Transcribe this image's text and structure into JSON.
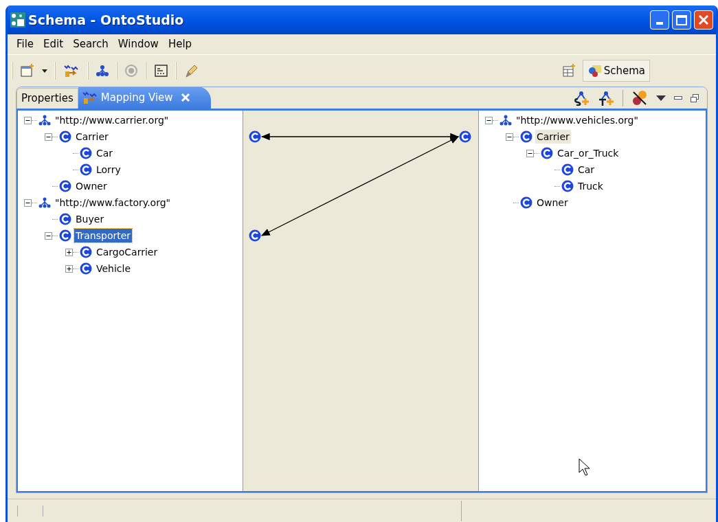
{
  "window": {
    "title": "Schema - OntoStudio"
  },
  "menu": [
    "File",
    "Edit",
    "Search",
    "Window",
    "Help"
  ],
  "perspective": {
    "label": "Schema",
    "selected": true
  },
  "view_tabs": [
    {
      "label": "Properties",
      "selected": false
    },
    {
      "label": "Mapping View",
      "selected": true
    }
  ],
  "source_tree": {
    "focused": true,
    "items": [
      {
        "kind": "ontology",
        "label": "\"http://www.carrier.org\"",
        "expanded": true,
        "selected": false,
        "mapped": false,
        "children": [
          {
            "kind": "class",
            "label": "Carrier",
            "expanded": true,
            "selected": false,
            "mapped": true,
            "children": [
              {
                "kind": "class",
                "label": "Car",
                "selected": false,
                "mapped": false
              },
              {
                "kind": "class",
                "label": "Lorry",
                "selected": false,
                "mapped": false
              }
            ]
          },
          {
            "kind": "class",
            "label": "Owner",
            "selected": false,
            "mapped": false
          }
        ]
      },
      {
        "kind": "ontology",
        "label": "\"http://www.factory.org\"",
        "expanded": true,
        "selected": false,
        "mapped": false,
        "children": [
          {
            "kind": "class",
            "label": "Buyer",
            "selected": false,
            "mapped": false
          },
          {
            "kind": "class",
            "label": "Transporter",
            "expanded": true,
            "selected": true,
            "mapped": true,
            "children": [
              {
                "kind": "class",
                "label": "CargoCarrier",
                "expanded": false,
                "selected": false,
                "mapped": false
              },
              {
                "kind": "class",
                "label": "Vehicle",
                "expanded": false,
                "selected": false,
                "mapped": false
              }
            ]
          }
        ]
      }
    ]
  },
  "target_tree": {
    "focused": false,
    "items": [
      {
        "kind": "ontology",
        "label": "\"http://www.vehicles.org\"",
        "expanded": true,
        "selected": false,
        "mapped": false,
        "children": [
          {
            "kind": "class",
            "label": "Carrier",
            "expanded": true,
            "selected": true,
            "mapped": true,
            "children": [
              {
                "kind": "class",
                "label": "Car_or_Truck",
                "expanded": true,
                "selected": false,
                "mapped": false,
                "children": [
                  {
                    "kind": "class",
                    "label": "Car",
                    "selected": false,
                    "mapped": false
                  },
                  {
                    "kind": "class",
                    "label": "Truck",
                    "selected": false,
                    "mapped": false
                  }
                ]
              }
            ]
          },
          {
            "kind": "class",
            "label": "Owner",
            "selected": false,
            "mapped": false
          }
        ]
      }
    ]
  }
}
